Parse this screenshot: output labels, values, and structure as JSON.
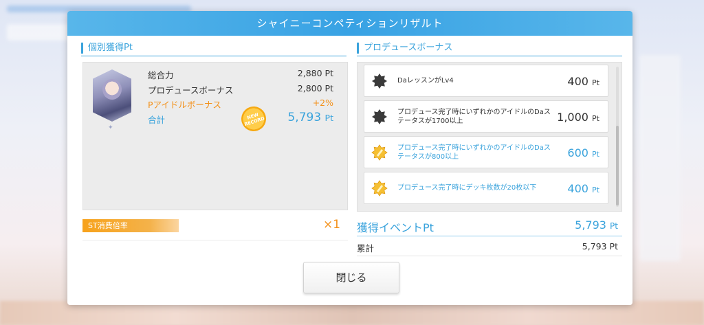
{
  "dialog": {
    "title": "シャイニーコンペティションリザルト",
    "close_label": "閉じる"
  },
  "individual": {
    "section_title": "個別獲得Pt",
    "stats": [
      {
        "label": "総合力",
        "value": "2,880",
        "unit": "Pt"
      },
      {
        "label": "プロデュースボーナス",
        "value": "2,800",
        "unit": "Pt"
      },
      {
        "label": "Pアイドルボーナス",
        "value": "+2%",
        "unit": ""
      }
    ],
    "total_label": "合計",
    "total_value": "5,793",
    "total_unit": "Pt",
    "new_record_badge": "NEW RECORD"
  },
  "produce_bonus": {
    "section_title": "プロデュースボーナス",
    "items": [
      {
        "text": "DaレッスンがLv4",
        "points": "400",
        "unit": "Pt",
        "achieved": false
      },
      {
        "text": "プロデュース完了時にいずれかのアイドルのDaステータスが1700以上",
        "points": "1,000",
        "unit": "Pt",
        "achieved": false
      },
      {
        "text": "プロデュース完了時にいずれかのアイドルのDaステータスが800以上",
        "points": "600",
        "unit": "Pt",
        "achieved": true
      },
      {
        "text": "プロデュース完了時にデッキ枚数が20枚以下",
        "points": "400",
        "unit": "Pt",
        "achieved": true
      }
    ]
  },
  "st_consumption": {
    "label": "ST消費倍率",
    "multiplier": "×1"
  },
  "event": {
    "label": "獲得イベントPt",
    "value": "5,793",
    "unit": "Pt",
    "cumulative_label": "累計",
    "cumulative_value": "5,793",
    "cumulative_unit": "Pt"
  },
  "colors": {
    "accent_blue": "#3aa3dc",
    "accent_orange": "#f39018",
    "header_blue": "#38a2e4"
  }
}
